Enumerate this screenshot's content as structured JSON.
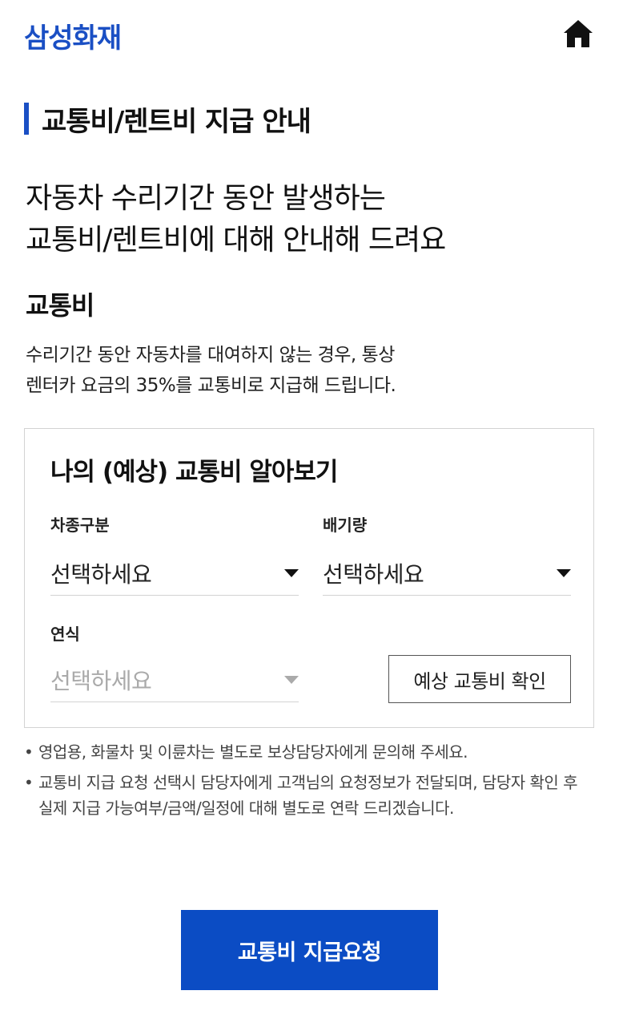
{
  "header": {
    "logo_text": "삼성화재",
    "home_icon": "home-icon",
    "brand_color": "#1a4fc4"
  },
  "page": {
    "section_title": "교통비/렌트비 지급 안내",
    "headline": [
      "자동차 수리기간 동안 발생하는",
      "교통비/렌트비에 대해 안내해 드려요"
    ],
    "sub_heading": "교통비",
    "description": [
      "수리기간 동안 자동차를 대여하지 않는 경우, 통상",
      "렌터카 요금의 35%를 교통비로 지급해 드립니다."
    ]
  },
  "calculator": {
    "title": "나의 (예상) 교통비 알아보기",
    "fields": [
      {
        "label": "차종구분",
        "value": "선택하세요",
        "disabled": false
      },
      {
        "label": "배기량",
        "value": "선택하세요",
        "disabled": false
      },
      {
        "label": "연식",
        "value": "선택하세요",
        "disabled": true
      }
    ],
    "confirm_button": "예상 교통비 확인"
  },
  "notes": [
    "영업용, 화물차 및 이륜차는 별도로 보상담당자에게 문의해 주세요.",
    "교통비 지급 요청 선택시 담당자에게 고객님의 요청정보가 전달되며, 담당자 확인 후 실제 지급 가능여부/금액/일정에 대해 별도로 연락 드리겠습니다."
  ],
  "cta": {
    "label": "교통비 지급요청",
    "color": "#0b4cc4"
  }
}
